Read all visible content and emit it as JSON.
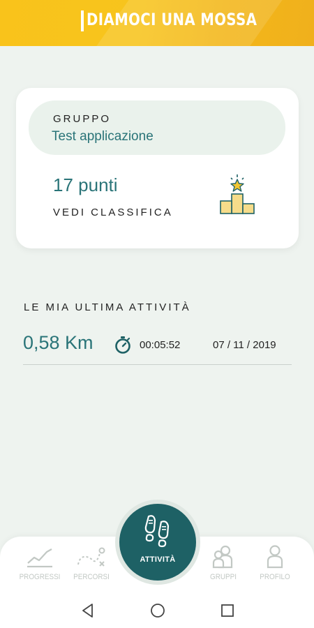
{
  "header": {
    "title": "DIAMOCI UNA MOSSA"
  },
  "group_card": {
    "label": "GRUPPO",
    "name": "Test applicazione",
    "points": "17 punti",
    "leaderboard_link": "VEDI CLASSIFICA",
    "icon": "podium-icon"
  },
  "last_activity": {
    "title": "LE MIA ULTIMA ATTIVITÀ",
    "distance": "0,58 Km",
    "duration": "00:05:52",
    "date": "07 / 11 / 2019",
    "icon": "stopwatch-icon"
  },
  "bottom_nav": {
    "items": [
      {
        "label": "PROGRESSI",
        "icon": "chart-icon"
      },
      {
        "label": "PERCORSI",
        "icon": "route-icon"
      },
      {
        "label": "ATTIVITÀ",
        "icon": "footsteps-icon"
      },
      {
        "label": "GRUPPI",
        "icon": "group-icon"
      },
      {
        "label": "PROFILO",
        "icon": "profile-icon"
      }
    ]
  },
  "colors": {
    "accent": "#1e6165",
    "header_yellow": "#f7c41d",
    "text_teal": "#2a7478",
    "background": "#eef3ef"
  }
}
